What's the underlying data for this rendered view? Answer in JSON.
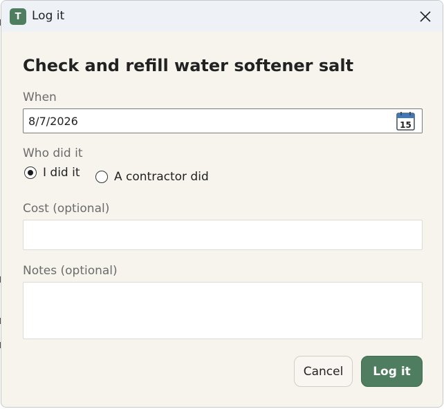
{
  "window": {
    "app_icon_letter": "T",
    "title": "Log it"
  },
  "form": {
    "heading": "Check and refill water softener salt",
    "when_label": "When",
    "when_value": "8/7/2026",
    "calendar_day": "15",
    "who_label": "Who did it",
    "options": [
      {
        "label": "I did it",
        "selected": true
      },
      {
        "label": "A contractor did",
        "selected": false
      }
    ],
    "cost_label": "Cost (optional)",
    "cost_value": "",
    "notes_label": "Notes (optional)",
    "notes_value": ""
  },
  "actions": {
    "cancel_label": "Cancel",
    "submit_label": "Log it"
  },
  "colors": {
    "accent": "#4e7d5f",
    "dialog_bg": "#f7f4ee",
    "titlebar_bg": "#eef2f7"
  }
}
